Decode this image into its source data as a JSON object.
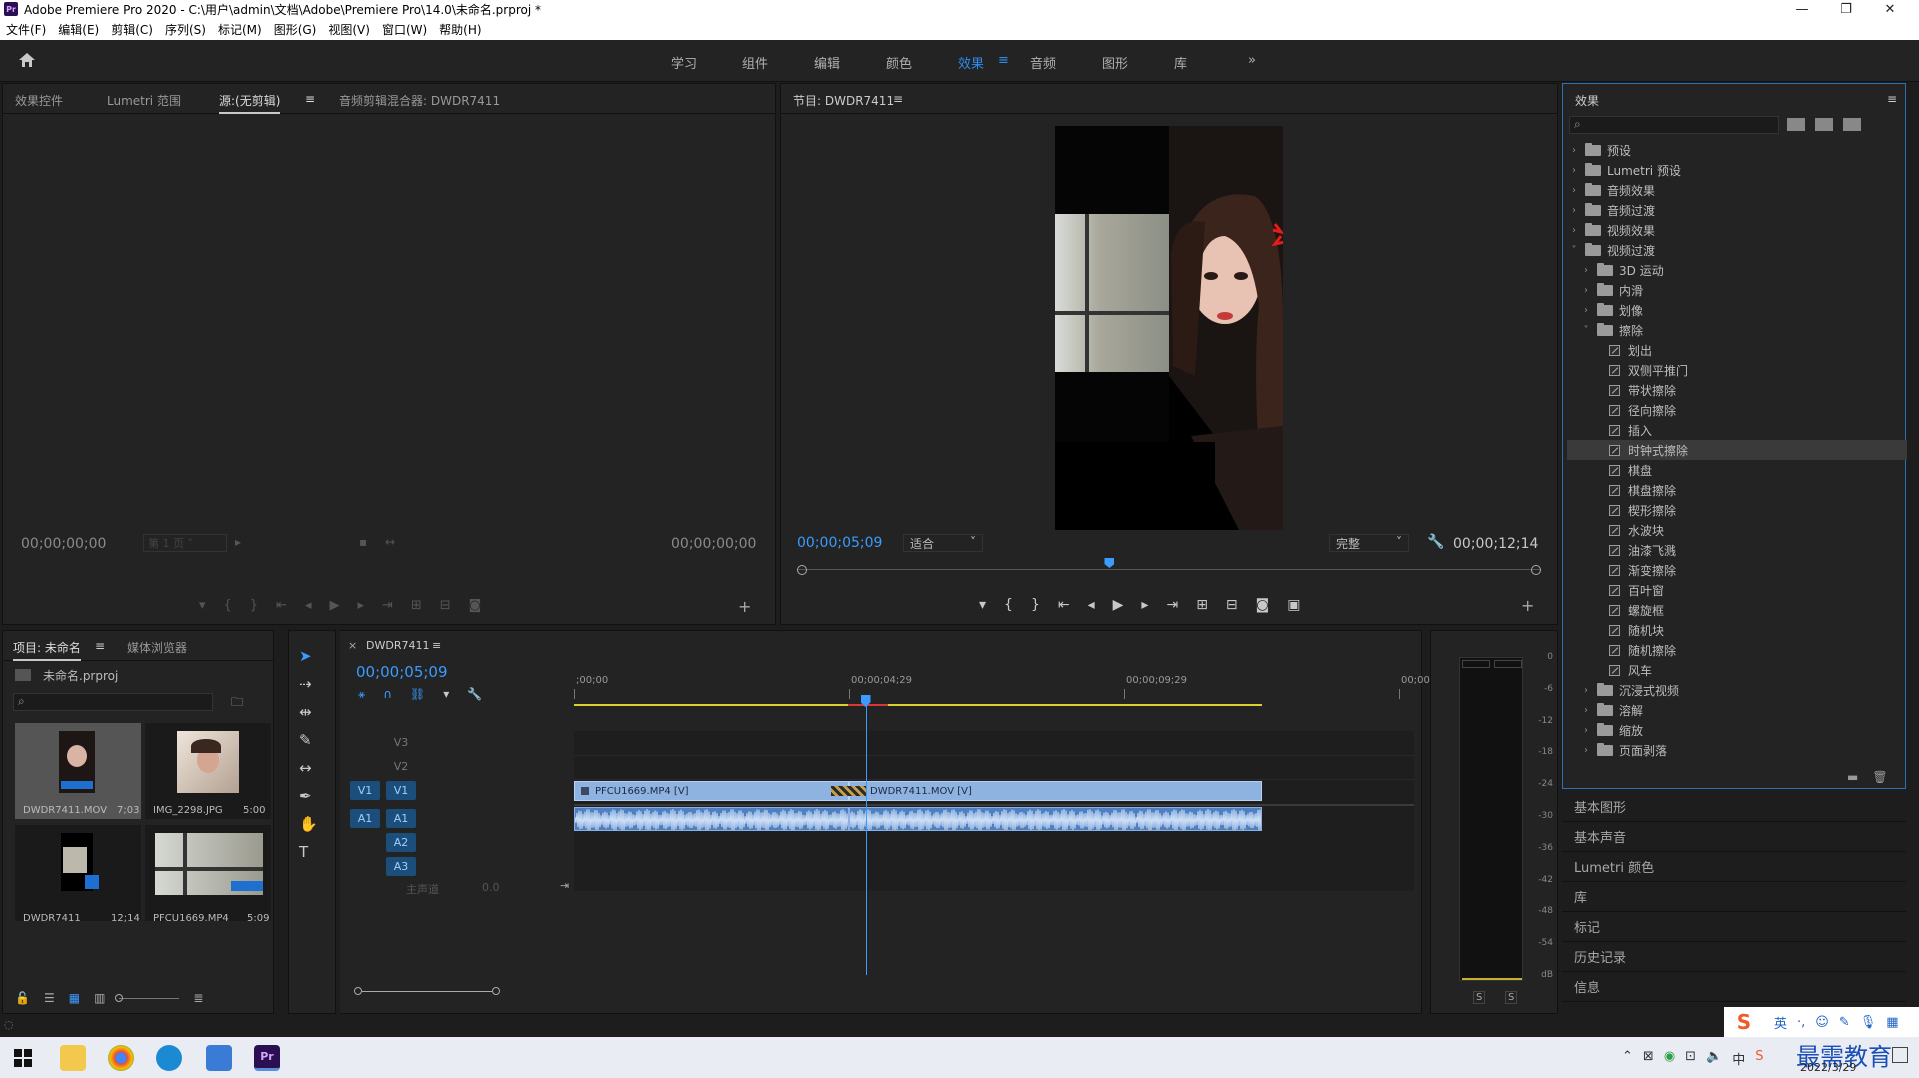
{
  "window": {
    "title": "Adobe Premiere Pro 2020 - C:\\用户\\admin\\文档\\Adobe\\Premiere Pro\\14.0\\未命名.prproj *"
  },
  "menu": [
    "文件(F)",
    "编辑(E)",
    "剪辑(C)",
    "序列(S)",
    "标记(M)",
    "图形(G)",
    "视图(V)",
    "窗口(W)",
    "帮助(H)"
  ],
  "workspaces": [
    "学习",
    "组件",
    "编辑",
    "颜色",
    "效果",
    "音频",
    "图形",
    "库"
  ],
  "active_workspace": "效果",
  "source_panel": {
    "tabs": [
      "效果控件",
      "Lumetri 范围",
      "源:(无剪辑)",
      "音频剪辑混合器: DWDR7411"
    ],
    "active_tab": "源:(无剪辑)",
    "timecode_left": "00;00;00;00",
    "timecode_right": "00;00;00;00",
    "page_select": "第 1 页"
  },
  "program_panel": {
    "title": "节目: DWDR7411",
    "timecode": "00;00;05;09",
    "fit": "适合",
    "quality": "完整",
    "duration": "00;00;12;14",
    "playhead_fraction": 0.42
  },
  "effects_panel": {
    "title": "效果",
    "tree": [
      {
        "label": "预设",
        "level": 0,
        "type": "folder-special",
        "open": false
      },
      {
        "label": "Lumetri 预设",
        "level": 0,
        "type": "folder-special",
        "open": false
      },
      {
        "label": "音频效果",
        "level": 0,
        "type": "folder",
        "open": false
      },
      {
        "label": "音频过渡",
        "level": 0,
        "type": "folder",
        "open": false
      },
      {
        "label": "视频效果",
        "level": 0,
        "type": "folder",
        "open": false
      },
      {
        "label": "视频过渡",
        "level": 0,
        "type": "folder",
        "open": true
      },
      {
        "label": "3D 运动",
        "level": 1,
        "type": "folder",
        "open": false
      },
      {
        "label": "内滑",
        "level": 1,
        "type": "folder",
        "open": false
      },
      {
        "label": "划像",
        "level": 1,
        "type": "folder",
        "open": false
      },
      {
        "label": "擦除",
        "level": 1,
        "type": "folder",
        "open": true
      },
      {
        "label": "划出",
        "level": 2,
        "type": "fx"
      },
      {
        "label": "双侧平推门",
        "level": 2,
        "type": "fx"
      },
      {
        "label": "带状擦除",
        "level": 2,
        "type": "fx"
      },
      {
        "label": "径向擦除",
        "level": 2,
        "type": "fx"
      },
      {
        "label": "插入",
        "level": 2,
        "type": "fx"
      },
      {
        "label": "时钟式擦除",
        "level": 2,
        "type": "fx",
        "selected": true
      },
      {
        "label": "棋盘",
        "level": 2,
        "type": "fx"
      },
      {
        "label": "棋盘擦除",
        "level": 2,
        "type": "fx"
      },
      {
        "label": "楔形擦除",
        "level": 2,
        "type": "fx"
      },
      {
        "label": "水波块",
        "level": 2,
        "type": "fx"
      },
      {
        "label": "油漆飞溅",
        "level": 2,
        "type": "fx"
      },
      {
        "label": "渐变擦除",
        "level": 2,
        "type": "fx"
      },
      {
        "label": "百叶窗",
        "level": 2,
        "type": "fx"
      },
      {
        "label": "螺旋框",
        "level": 2,
        "type": "fx"
      },
      {
        "label": "随机块",
        "level": 2,
        "type": "fx"
      },
      {
        "label": "随机擦除",
        "level": 2,
        "type": "fx"
      },
      {
        "label": "风车",
        "level": 2,
        "type": "fx"
      },
      {
        "label": "沉浸式视频",
        "level": 1,
        "type": "folder",
        "open": false
      },
      {
        "label": "溶解",
        "level": 1,
        "type": "folder",
        "open": false
      },
      {
        "label": "缩放",
        "level": 1,
        "type": "folder",
        "open": false
      },
      {
        "label": "页面剥落",
        "level": 1,
        "type": "folder",
        "open": false
      }
    ],
    "collapsed_panels": [
      "基本图形",
      "基本声音",
      "Lumetri 颜色",
      "库",
      "标记",
      "历史记录",
      "信息"
    ]
  },
  "project_panel": {
    "tabs": [
      "项目: 未命名",
      "媒体浏览器"
    ],
    "file": "未命名.prproj",
    "items": [
      {
        "name": "DWDR7411.MOV",
        "duration": "7;03"
      },
      {
        "name": "IMG_2298.JPG",
        "duration": "5:00"
      },
      {
        "name": "DWDR7411",
        "duration": "12;14"
      },
      {
        "name": "PFCU1669.MP4",
        "duration": "5:09"
      }
    ]
  },
  "timeline": {
    "sequence": "DWDR7411",
    "timecode": "00;00;05;09",
    "ruler": [
      ";00;00",
      "00;00;04;29",
      "00;00;09;29",
      "00;00;14;"
    ],
    "ruler_seconds": [
      0,
      5,
      10,
      15
    ],
    "playhead_seconds": 5.3,
    "video_tracks": [
      "V3",
      "V2",
      "V1"
    ],
    "audio_tracks": [
      "A1",
      "A2",
      "A3"
    ],
    "master_label": "主声道",
    "master_value": "0.0",
    "clips_v1": [
      {
        "name": "PFCU1669.MP4 [V]",
        "start_s": 0,
        "end_s": 5.0
      },
      {
        "name": "DWDR7411.MOV [V]",
        "start_s": 5.0,
        "end_s": 12.5
      }
    ]
  },
  "audio_meter": {
    "ticks": [
      "0",
      "-6",
      "-12",
      "-18",
      "-24",
      "-30",
      "-36",
      "-42",
      "-48",
      "-54",
      "dB"
    ],
    "solo": [
      "S",
      "S"
    ]
  },
  "taskbar": {
    "ime": "英",
    "date": "2022/3/29",
    "watermark": "最需教育"
  }
}
